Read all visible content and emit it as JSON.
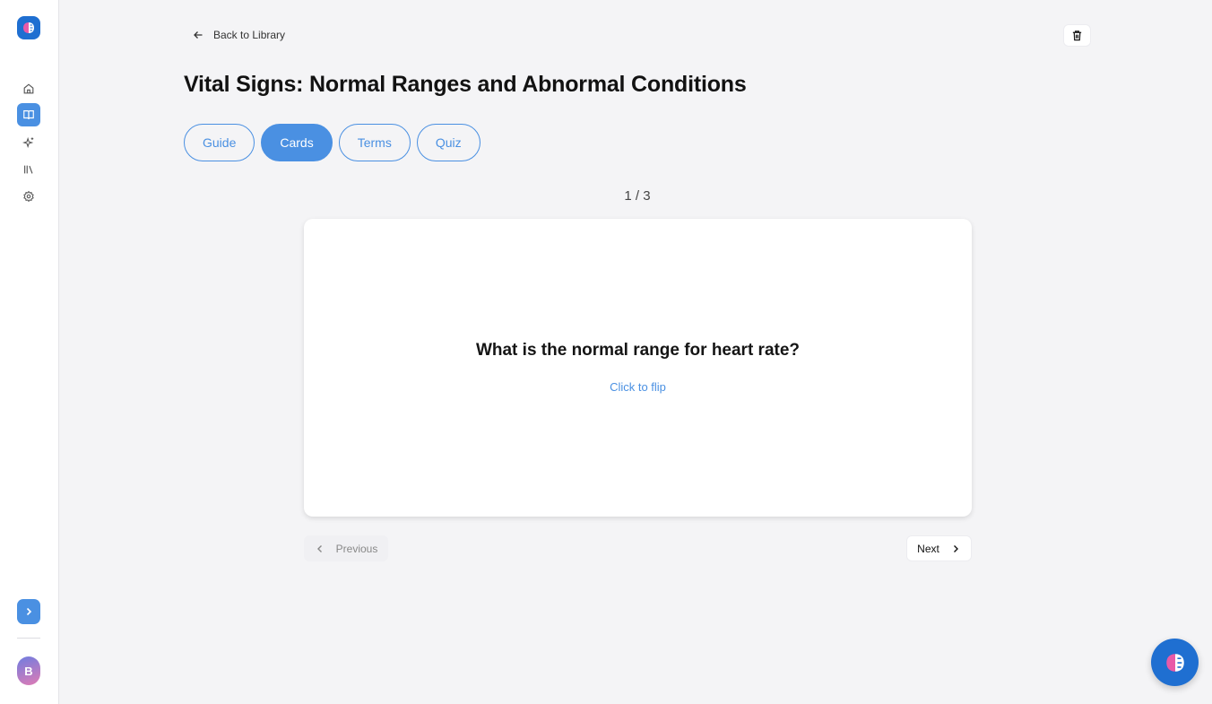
{
  "back_link": {
    "label": "Back to Library"
  },
  "page": {
    "title": "Vital Signs: Normal Ranges and Abnormal Conditions"
  },
  "tabs": [
    {
      "label": "Guide",
      "active": false
    },
    {
      "label": "Cards",
      "active": true
    },
    {
      "label": "Terms",
      "active": false
    },
    {
      "label": "Quiz",
      "active": false
    }
  ],
  "flashcard": {
    "counter": "1 / 3",
    "question": "What is the normal range for heart rate?",
    "hint": "Click to flip"
  },
  "navigation": {
    "previous_label": "Previous",
    "next_label": "Next"
  },
  "user": {
    "avatar_initial": "B"
  },
  "colors": {
    "accent": "#4a90e2",
    "brand": "#1f6fd1",
    "background": "#f4f4f6"
  },
  "icons": {
    "sidebar": [
      "home-icon",
      "book-icon",
      "sparkles-icon",
      "library-icon",
      "gear-icon"
    ],
    "header": [
      "arrow-left-icon",
      "trash-icon"
    ],
    "nav": [
      "chevron-left-icon",
      "chevron-right-icon"
    ]
  }
}
